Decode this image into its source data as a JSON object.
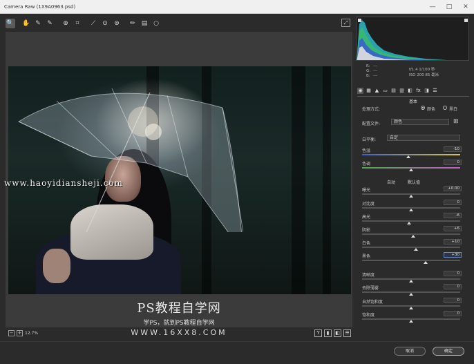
{
  "window": {
    "title": "Camera Raw (1X9A0963.psd)",
    "controls": [
      "—",
      "□",
      "✕"
    ]
  },
  "toolbar": {
    "tools": [
      {
        "name": "zoom-tool-icon",
        "glyph": "🔍",
        "active": true
      },
      {
        "name": "hand-tool-icon",
        "glyph": "✋",
        "active": false
      },
      {
        "name": "white-balance-tool-icon",
        "glyph": "✎",
        "active": false
      },
      {
        "name": "color-sampler-tool-icon",
        "glyph": "✎",
        "active": false
      },
      {
        "name": "targeted-adjustment-tool-icon",
        "glyph": "⊕",
        "active": false
      },
      {
        "name": "crop-tool-icon",
        "glyph": "⌗",
        "active": false
      },
      {
        "name": "straighten-tool-icon",
        "glyph": "⟋",
        "active": false
      },
      {
        "name": "spot-removal-tool-icon",
        "glyph": "⊙",
        "active": false
      },
      {
        "name": "red-eye-tool-icon",
        "glyph": "⊚",
        "active": false
      },
      {
        "name": "adjustment-brush-icon",
        "glyph": "✏",
        "active": false
      },
      {
        "name": "graduated-filter-icon",
        "glyph": "▤",
        "active": false
      },
      {
        "name": "radial-filter-icon",
        "glyph": "○",
        "active": false
      }
    ],
    "fullscreen_glyph": "⤢"
  },
  "watermarks": {
    "site_top": "www.haoyidiansheji.com",
    "brand_big": "PS教程自学网",
    "brand_sub": "学PS，就到PS教程自学网",
    "brand_url": "WWW.16XX8.COM"
  },
  "zoom": {
    "value": "12.7%",
    "minus": "−",
    "plus": "+"
  },
  "view_buttons": [
    "Y",
    "▮",
    "◧",
    "☰"
  ],
  "readout": {
    "r_label": "R:",
    "r_val": "---",
    "g_label": "G:",
    "g_val": "---",
    "b_label": "B:",
    "b_val": "---",
    "exposure_info_1": "f/1.4   1/100 秒",
    "exposure_info_2": "ISO 200   85 毫米"
  },
  "panel_tabs": [
    "◉",
    "▦",
    "▲",
    "▭",
    "▤",
    "▥",
    "◧",
    "fx",
    "◨",
    "☰"
  ],
  "panel": {
    "title": "基本",
    "treatment_label": "处理方式:",
    "treatment_color": "颜色",
    "treatment_bw": "黑白",
    "profile_label": "配置文件:",
    "profile_value": "颜色",
    "profile_grid_glyph": "⊞",
    "wb_label": "白平衡:",
    "wb_value": "自定",
    "auto_label": "自动",
    "default_label": "默认值"
  },
  "sliders": [
    {
      "label": "色温",
      "value": "-10",
      "pos": 0.47,
      "kind": "temp"
    },
    {
      "label": "色调",
      "value": "0",
      "pos": 0.5,
      "kind": "tint"
    },
    {
      "label": "曝光",
      "value": "+0.00",
      "pos": 0.5,
      "kind": "plain"
    },
    {
      "label": "对比度",
      "value": "0",
      "pos": 0.5,
      "kind": "plain"
    },
    {
      "label": "高光",
      "value": "-6",
      "pos": 0.48,
      "kind": "plain"
    },
    {
      "label": "阴影",
      "value": "+6",
      "pos": 0.52,
      "kind": "plain"
    },
    {
      "label": "白色",
      "value": "+10",
      "pos": 0.55,
      "kind": "plain"
    },
    {
      "label": "黑色",
      "value": "+30",
      "pos": 0.65,
      "kind": "plain",
      "highlight": true
    },
    {
      "label": "清晰度",
      "value": "0",
      "pos": 0.5,
      "kind": "plain"
    },
    {
      "label": "去除薄雾",
      "value": "0",
      "pos": 0.5,
      "kind": "plain"
    },
    {
      "label": "自然饱和度",
      "value": "0",
      "pos": 0.5,
      "kind": "plain"
    },
    {
      "label": "饱和度",
      "value": "0",
      "pos": 0.5,
      "kind": "plain"
    }
  ],
  "buttons": {
    "cancel": "取消",
    "ok": "确定"
  }
}
